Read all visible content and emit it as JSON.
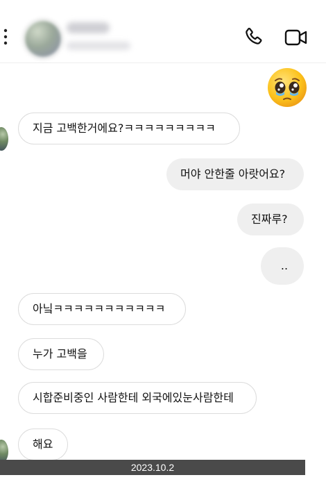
{
  "header": {
    "icons": {
      "back": "back-chevron-icon",
      "call": "phone-icon",
      "video": "video-camera-icon"
    }
  },
  "messages": [
    {
      "id": "m1",
      "side": "received",
      "text": "지금 고백한거에요?ㅋㅋㅋㅋㅋㅋㅋㅋㅋ"
    },
    {
      "id": "m2",
      "side": "sent",
      "text": "머야 안한줄 아랏어요?"
    },
    {
      "id": "m3",
      "side": "sent",
      "text": "진짜루?"
    },
    {
      "id": "m4",
      "side": "sent",
      "text": ".."
    },
    {
      "id": "m5",
      "side": "received",
      "text": "아닠ㅋㅋㅋㅋㅋㅋㅋㅋㅋㅋㅋ"
    },
    {
      "id": "m6",
      "side": "received",
      "text": "누가 고백을"
    },
    {
      "id": "m7",
      "side": "received",
      "text": "시합준비중인 사람한테 외국에있눈사람한테"
    },
    {
      "id": "m8",
      "side": "received",
      "text": "해요"
    }
  ],
  "emoji": "pleading-face",
  "date_stamp": "2023.10.2",
  "colors": {
    "sent_bubble": "#efefef",
    "received_border": "#dcdcdc",
    "date_strip": "#4a4a4a"
  }
}
